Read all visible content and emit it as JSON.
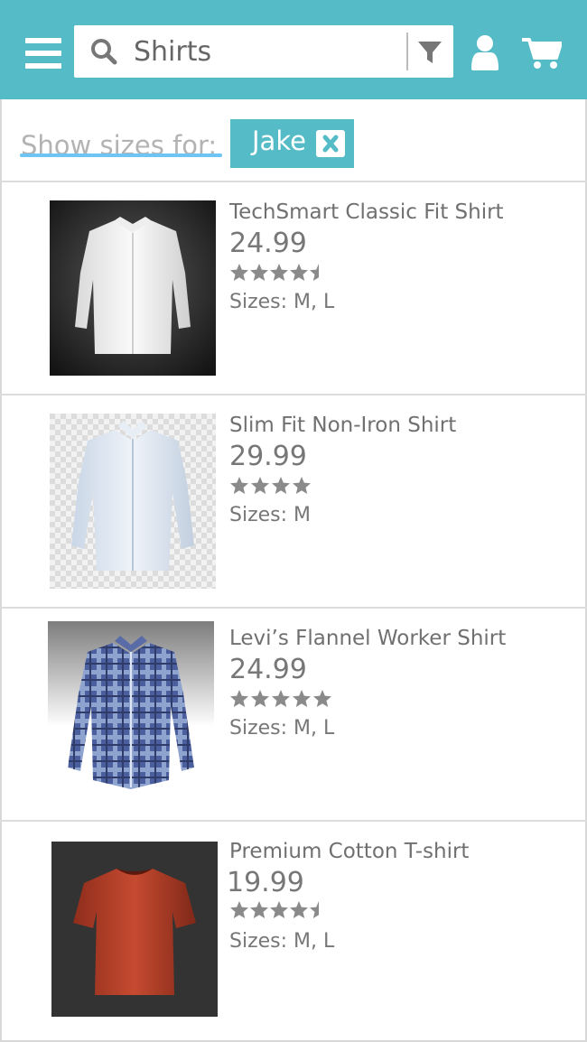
{
  "header": {
    "menu_icon": "hamburger-menu-icon",
    "search": {
      "value": "Shirts",
      "icon": "search-icon"
    },
    "filter_icon": "filter-funnel-icon",
    "user_icon": "user-icon",
    "cart_icon": "shopping-cart-icon",
    "bar_color": "#55bcc7"
  },
  "sizes_filter": {
    "label": "Show sizes for:",
    "chip": {
      "name": "Jake",
      "remove_icon": "close-icon"
    }
  },
  "products": [
    {
      "name": "TechSmart Classic Fit Shirt",
      "price": "24.99",
      "rating": 4.5,
      "sizes": "Sizes: M, L",
      "image": "white dress shirt on dark background"
    },
    {
      "name": "Slim Fit Non-Iron Shirt",
      "price": "29.99",
      "rating": 4,
      "sizes": "Sizes: M",
      "image": "light blue dress shirt on checkered background"
    },
    {
      "name": "Levi’s Flannel Worker Shirt",
      "price": "24.99",
      "rating": 5,
      "sizes": "Sizes: M, L",
      "image": "blue plaid flannel shirt"
    },
    {
      "name": "Premium Cotton T-shirt",
      "price": "19.99",
      "rating": 4.5,
      "sizes": "Sizes: M, L",
      "image": "red t-shirt on dark background"
    }
  ]
}
